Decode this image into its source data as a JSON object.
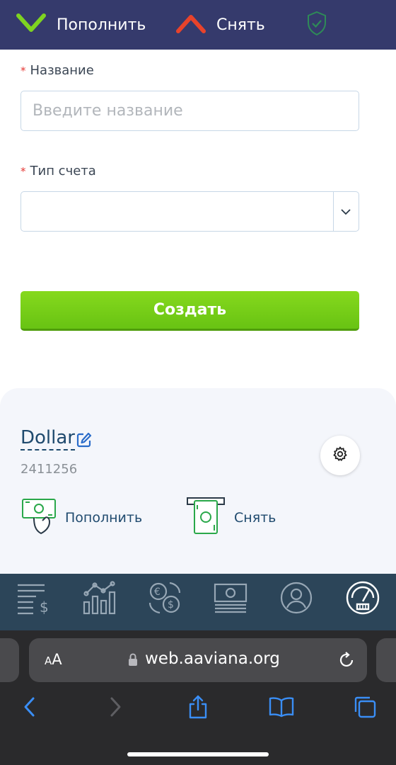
{
  "topbar": {
    "deposit_label": "Пополнить",
    "withdraw_label": "Снять",
    "colors": {
      "background": "#353a6c",
      "deposit_icon": "#7ed321",
      "withdraw_icon": "#e8432b",
      "shield_icon": "#2e8b57"
    },
    "icons": [
      "chevron-up-green-icon",
      "chevron-up-red-icon",
      "shield-check-icon"
    ]
  },
  "form": {
    "name_required_mark": "*",
    "name_label": "Название",
    "name_placeholder": "Введите название",
    "name_value": "",
    "type_required_mark": "*",
    "type_label": "Тип счета",
    "type_value": "",
    "submit_label": "Создать",
    "submit_color": "#76cd19"
  },
  "account": {
    "name": "Dollar",
    "number": "2411256",
    "deposit_label": "Пополнить",
    "withdraw_label": "Снять",
    "icons": [
      "edit-icon",
      "gear-icon",
      "cash-hand-icon",
      "cash-withdraw-icon"
    ]
  },
  "app_nav": {
    "items": [
      "transactions-icon",
      "analytics-chart-icon",
      "currency-exchange-icon",
      "banknote-icon",
      "profile-icon",
      "dashboard-gauge-icon"
    ],
    "active": "dashboard-gauge-icon",
    "background": "#2c4559"
  },
  "browser": {
    "aa_small": "A",
    "aa_big": "A",
    "url": "web.aaviana.org",
    "toolbar_icons": [
      "back-icon",
      "forward-icon",
      "share-icon",
      "bookmarks-icon",
      "tabs-icon"
    ],
    "accent": "#3a8ef6"
  }
}
